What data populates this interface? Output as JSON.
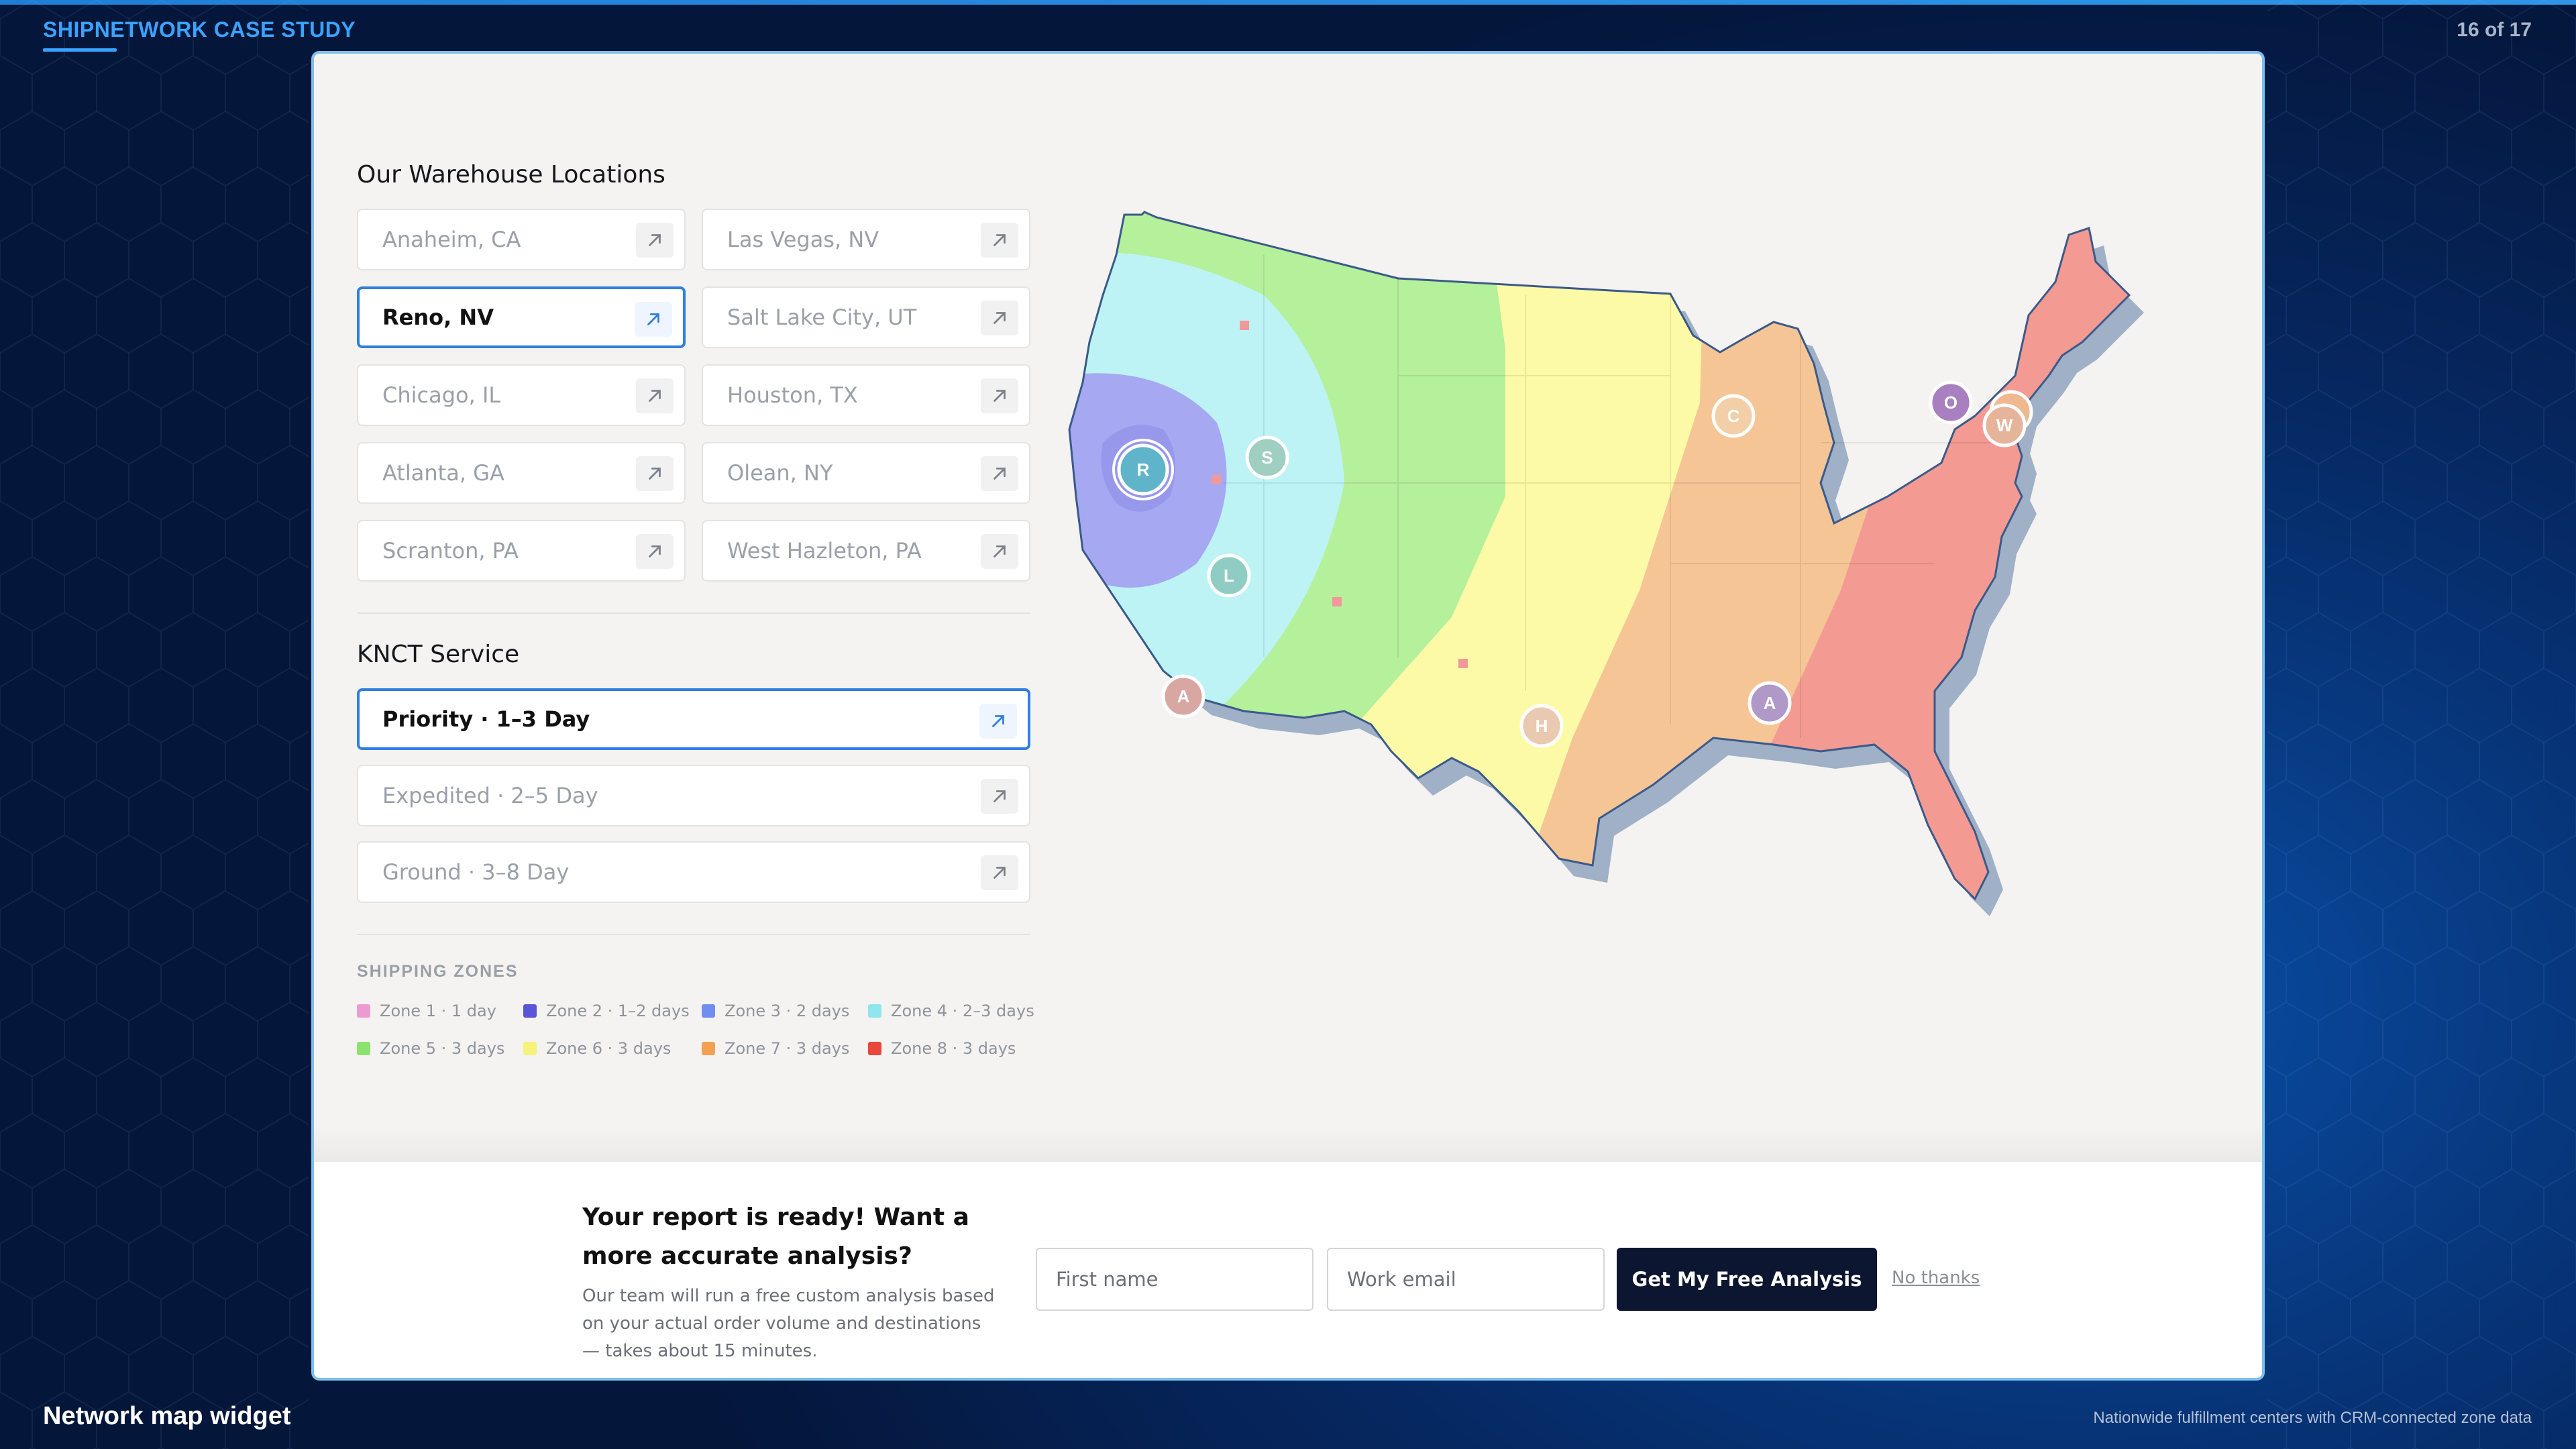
{
  "deck": {
    "title": "SHIPNETWORK CASE STUDY",
    "page": "16 of 17",
    "caption": "Network map widget",
    "footnote": "Nationwide fulfillment centers with CRM-connected zone data"
  },
  "warehouses": {
    "title": "Our Warehouse Locations",
    "items": [
      {
        "label": "Anaheim, CA",
        "active": false
      },
      {
        "label": "Las Vegas, NV",
        "active": false
      },
      {
        "label": "Reno, NV",
        "active": true
      },
      {
        "label": "Salt Lake City, UT",
        "active": false
      },
      {
        "label": "Chicago, IL",
        "active": false
      },
      {
        "label": "Houston, TX",
        "active": false
      },
      {
        "label": "Atlanta, GA",
        "active": false
      },
      {
        "label": "Olean, NY",
        "active": false
      },
      {
        "label": "Scranton, PA",
        "active": false
      },
      {
        "label": "West Hazleton, PA",
        "active": false
      }
    ]
  },
  "service": {
    "title": "KNCT Service",
    "items": [
      {
        "label": "Priority · 1–3 Day",
        "active": true
      },
      {
        "label": "Expedited · 2–5 Day",
        "active": false
      },
      {
        "label": "Ground · 3–8 Day",
        "active": false
      }
    ]
  },
  "zones": {
    "title": "SHIPPING ZONES",
    "items": [
      {
        "label": "Zone 1 · 1 day",
        "color": "#ec9bd2"
      },
      {
        "label": "Zone 2 · 1–2 days",
        "color": "#5a55d8"
      },
      {
        "label": "Zone 3 · 2 days",
        "color": "#6f8ef0"
      },
      {
        "label": "Zone 4 · 2–3 days",
        "color": "#8ee6ee"
      },
      {
        "label": "Zone 5 · 3 days",
        "color": "#8ce26e"
      },
      {
        "label": "Zone 6 · 3 days",
        "color": "#f7f27a"
      },
      {
        "label": "Zone 7 · 3 days",
        "color": "#f2a052"
      },
      {
        "label": "Zone 8 · 3 days",
        "color": "#e9463e"
      }
    ]
  },
  "map": {
    "zone_fills": {
      "zone3": "#a6a8f2",
      "zone4": "#bdf3f5",
      "zone5": "#b5f09a",
      "zone6": "#fdfaa7",
      "zone7": "#f6c596",
      "zone8": "#f39a92",
      "land_shadow": "#9fb0c7"
    },
    "markers": [
      {
        "letter": "R",
        "selected": true
      },
      {
        "letter": "S",
        "selected": false
      },
      {
        "letter": "L",
        "selected": false
      },
      {
        "letter": "A",
        "selected": false
      },
      {
        "letter": "H",
        "selected": false
      },
      {
        "letter": "C",
        "selected": false
      },
      {
        "letter": "A",
        "selected": false
      },
      {
        "letter": "O",
        "selected": false
      },
      {
        "letter": "S",
        "selected": false
      },
      {
        "letter": "W",
        "selected": false
      }
    ]
  },
  "cta": {
    "headline": "Your report is ready! Want a more accurate analysis?",
    "body": "Our team will run a free custom analysis based on your actual order volume and destinations — takes about 15 minutes.",
    "first_name_placeholder": "First name",
    "email_placeholder": "Work email",
    "button": "Get My Free Analysis",
    "dismiss": "No thanks"
  }
}
